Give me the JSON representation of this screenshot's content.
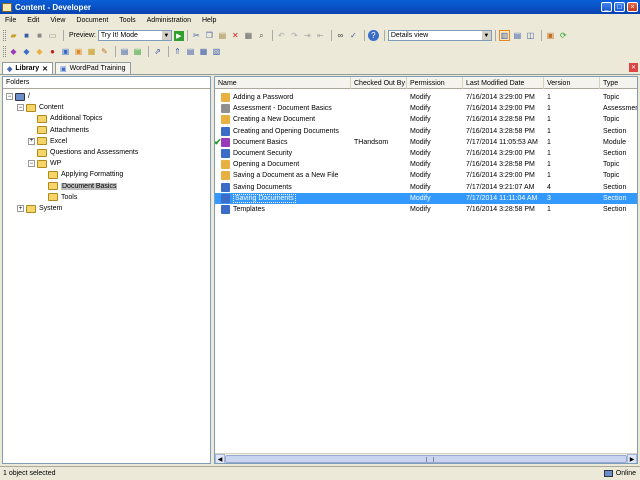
{
  "window": {
    "title": "Content - Developer"
  },
  "menu": [
    "File",
    "Edit",
    "View",
    "Document",
    "Tools",
    "Administration",
    "Help"
  ],
  "toolbar": {
    "preview_label": "Preview:",
    "preview_mode": "Try It! Mode",
    "view_mode": "Details view"
  },
  "tabs": [
    {
      "label": "Library"
    },
    {
      "label": "WordPad Training"
    }
  ],
  "folders": {
    "header": "Folders",
    "items": [
      {
        "label": "/",
        "level": 0,
        "expander": "-"
      },
      {
        "label": "Content",
        "level": 1,
        "expander": "-"
      },
      {
        "label": "Additional Topics",
        "level": 2,
        "expander": ""
      },
      {
        "label": "Attachments",
        "level": 2,
        "expander": ""
      },
      {
        "label": "Excel",
        "level": 2,
        "expander": "+"
      },
      {
        "label": "Questions and Assessments",
        "level": 2,
        "expander": ""
      },
      {
        "label": "WP",
        "level": 2,
        "expander": "-"
      },
      {
        "label": "Applying Formatting",
        "level": 3,
        "expander": ""
      },
      {
        "label": "Document Basics",
        "level": 3,
        "expander": "",
        "selected": true
      },
      {
        "label": "Tools",
        "level": 3,
        "expander": ""
      },
      {
        "label": "System",
        "level": 1,
        "expander": "+"
      }
    ]
  },
  "list": {
    "columns": [
      "Name",
      "Checked Out By",
      "Permission",
      "Last Modified Date",
      "Version",
      "Type"
    ],
    "rows": [
      {
        "name": "Adding a Password",
        "checked_out_by": "",
        "permission": "Modify",
        "modified": "7/16/2014 3:29:00 PM",
        "version": "1",
        "type": "Topic",
        "icon": "topic-icon",
        "icon_color": "#e8b040"
      },
      {
        "name": "Assessment - Document Basics",
        "checked_out_by": "",
        "permission": "Modify",
        "modified": "7/16/2014 3:29:00 PM",
        "version": "1",
        "type": "Assessment",
        "icon": "assessment-icon",
        "icon_color": "#909090"
      },
      {
        "name": "Creating a New Document",
        "checked_out_by": "",
        "permission": "Modify",
        "modified": "7/16/2014 3:28:58 PM",
        "version": "1",
        "type": "Topic",
        "icon": "topic-icon",
        "icon_color": "#e8b040"
      },
      {
        "name": "Creating and Opening Documents",
        "checked_out_by": "",
        "permission": "Modify",
        "modified": "7/16/2014 3:28:58 PM",
        "version": "1",
        "type": "Section",
        "icon": "section-icon",
        "icon_color": "#3a6cc8"
      },
      {
        "name": "Document Basics",
        "checked_out_by": "THandsom",
        "permission": "Modify",
        "modified": "7/17/2014 11:05:53 AM",
        "version": "1",
        "type": "Module",
        "icon": "module-icon",
        "icon_color": "#9a3ab8",
        "checked": true
      },
      {
        "name": "Document Security",
        "checked_out_by": "",
        "permission": "Modify",
        "modified": "7/16/2014 3:29:00 PM",
        "version": "1",
        "type": "Section",
        "icon": "section-icon",
        "icon_color": "#3a6cc8"
      },
      {
        "name": "Opening a Document",
        "checked_out_by": "",
        "permission": "Modify",
        "modified": "7/16/2014 3:28:58 PM",
        "version": "1",
        "type": "Topic",
        "icon": "topic-icon",
        "icon_color": "#e8b040"
      },
      {
        "name": "Saving a Document as a New File",
        "checked_out_by": "",
        "permission": "Modify",
        "modified": "7/16/2014 3:29:00 PM",
        "version": "1",
        "type": "Topic",
        "icon": "topic-icon",
        "icon_color": "#e8b040"
      },
      {
        "name": "Saving Documents",
        "checked_out_by": "",
        "permission": "Modify",
        "modified": "7/17/2014 9:21:07 AM",
        "version": "4",
        "type": "Section",
        "icon": "section-icon",
        "icon_color": "#3a6cc8"
      },
      {
        "name": "Saving Documents",
        "checked_out_by": "",
        "permission": "Modify",
        "modified": "7/17/2014 11:11:04 AM",
        "version": "3",
        "type": "Section",
        "icon": "section-icon",
        "icon_color": "#3a6cc8",
        "selected": true
      },
      {
        "name": "Templates",
        "checked_out_by": "",
        "permission": "Modify",
        "modified": "7/16/2014 3:28:58 PM",
        "version": "1",
        "type": "Section",
        "icon": "section-icon",
        "icon_color": "#3a6cc8"
      }
    ]
  },
  "status": {
    "message": "1 object selected",
    "connection": "Online"
  },
  "colors": {
    "selection": "#3399ff",
    "titlebar": "#0a5fd8"
  }
}
